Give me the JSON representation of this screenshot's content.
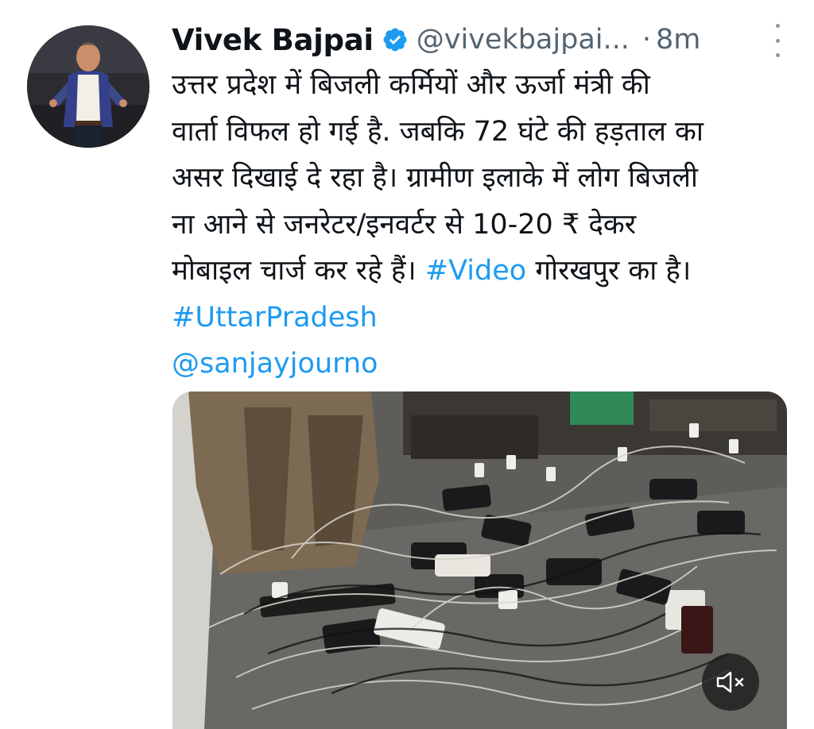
{
  "tweet": {
    "author_name": "Vivek Bajpai",
    "handle": "@vivekbajpai...",
    "separator": "·",
    "time": "8m",
    "text_lines": [
      "उत्तर प्रदेश में बिजली कर्मियों और ऊर्जा मंत्री की",
      "वार्ता विफल हो गई है. जबकि 72 घंटे की हड़ताल का",
      "असर दिखाई दे रहा है। ग्रामीण इलाके में लोग बिजली",
      "ना आने से जनरेटर/इनवर्टर से 10-20 ₹ देकर"
    ],
    "line5_before": "मोबाइल चार्ज कर रहे हैं। ",
    "hashtag_video": "#Video",
    "line5_after": " गोरखपुर का है।",
    "hashtag_state": "#UttarPradesh",
    "mention": "@sanjayjourno"
  },
  "icons": {
    "verified": "verified-badge-icon",
    "more": "more-vertical-icon",
    "mute": "speaker-muted-icon"
  },
  "colors": {
    "link": "#1d9bf0",
    "secondary_text": "#536471",
    "verified_badge": "#1d9bf0"
  }
}
